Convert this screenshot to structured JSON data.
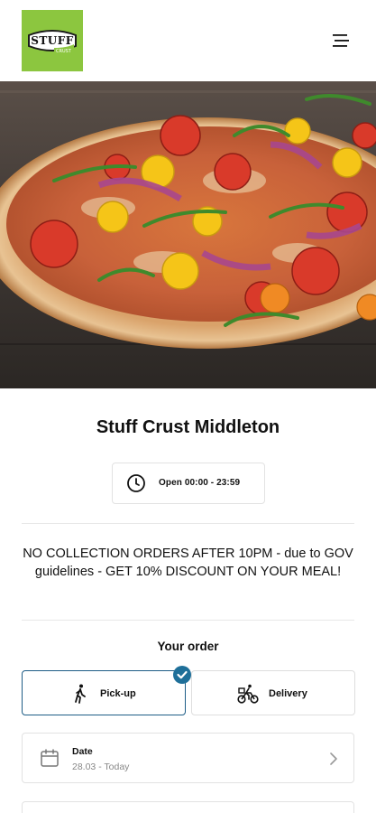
{
  "header": {
    "logo_text": "STUFF",
    "logo_subtext": "CRUST",
    "menu_icon": "hamburger-menu-icon"
  },
  "hero": {
    "icon": "pizza-photo"
  },
  "restaurant": {
    "name": "Stuff Crust Middleton",
    "hours": "Open 00:00 - 23:59"
  },
  "notice": {
    "text": "NO COLLECTION ORDERS AFTER 10PM - due to GOV guidelines - GET 10% DISCOUNT ON YOUR MEAL!"
  },
  "order": {
    "heading": "Your order",
    "options": [
      {
        "label": "Pick-up",
        "icon": "walking-person-icon",
        "selected": true
      },
      {
        "label": "Delivery",
        "icon": "bicycle-courier-icon",
        "selected": false
      }
    ],
    "date": {
      "label": "Date",
      "value": "28.03 - Today",
      "icon": "calendar-icon"
    }
  },
  "colors": {
    "brand_green": "#8cc63f",
    "accent_blue": "#1e6f99",
    "selected_border": "#1e5d86"
  }
}
